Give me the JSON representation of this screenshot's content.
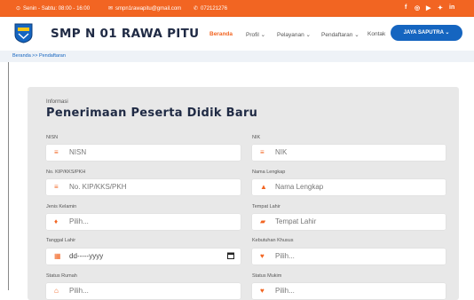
{
  "topbar": {
    "hours": "Senin - Sabtu: 08:00 - 16:00",
    "email": "smpn1rawapitu@gmail.com",
    "phone": "072121276",
    "social_icons": [
      "facebook-icon",
      "instagram-icon",
      "youtube-icon",
      "twitter-icon",
      "linkedin-icon"
    ],
    "social_glyphs": [
      "f",
      "◎",
      "▶",
      "✦",
      "in"
    ]
  },
  "brand": {
    "name": "SMP N 01 RAWA PITU"
  },
  "nav": {
    "items": [
      "Beranda",
      "Profil ⌄",
      "Pelayanan ⌄",
      "Pendaftaran ⌄",
      "Kontak"
    ],
    "active": "Beranda",
    "user": "JAYA SAPUTRA ⌄"
  },
  "breadcrumb": {
    "home": "Beranda",
    "current": ">> Pendaftaran"
  },
  "form": {
    "info": "Informasi",
    "title": "Penerimaan Peserta Didik Baru",
    "fields": [
      {
        "label": "NISN",
        "placeholder": "NISN",
        "icon": "list-icon",
        "glyph": "≡"
      },
      {
        "label": "NIK",
        "placeholder": "NIK",
        "icon": "list-icon",
        "glyph": "≡"
      },
      {
        "label": "No. KIP/KKS/PKH",
        "placeholder": "No. KIP/KKS/PKH",
        "icon": "list-icon",
        "glyph": "≡"
      },
      {
        "label": "Nama Lengkap",
        "placeholder": "Nama Lengkap",
        "icon": "user-icon",
        "glyph": "▲"
      },
      {
        "label": "Jenis Kelamin",
        "placeholder": "Pilih...",
        "icon": "gender-icon",
        "glyph": "♦"
      },
      {
        "label": "Tempat Lahir",
        "placeholder": "Tempat Lahir",
        "icon": "flag-icon",
        "glyph": "▰"
      },
      {
        "label": "Tanggal Lahir",
        "placeholder": "dd-----yyyy",
        "icon": "calendar-icon",
        "glyph": "▦"
      },
      {
        "label": "Kebutuhan Khusus",
        "placeholder": "Pilih...",
        "icon": "location-icon",
        "glyph": "♥"
      },
      {
        "label": "Status Rumah",
        "placeholder": "Pilih...",
        "icon": "home-icon",
        "glyph": "⌂"
      },
      {
        "label": "Status Mukim",
        "placeholder": "Pilih...",
        "icon": "location-icon",
        "glyph": "♥"
      }
    ]
  },
  "colors": {
    "accent": "#f26522",
    "primary": "#1565c0",
    "brand_text": "#1f2a44"
  }
}
